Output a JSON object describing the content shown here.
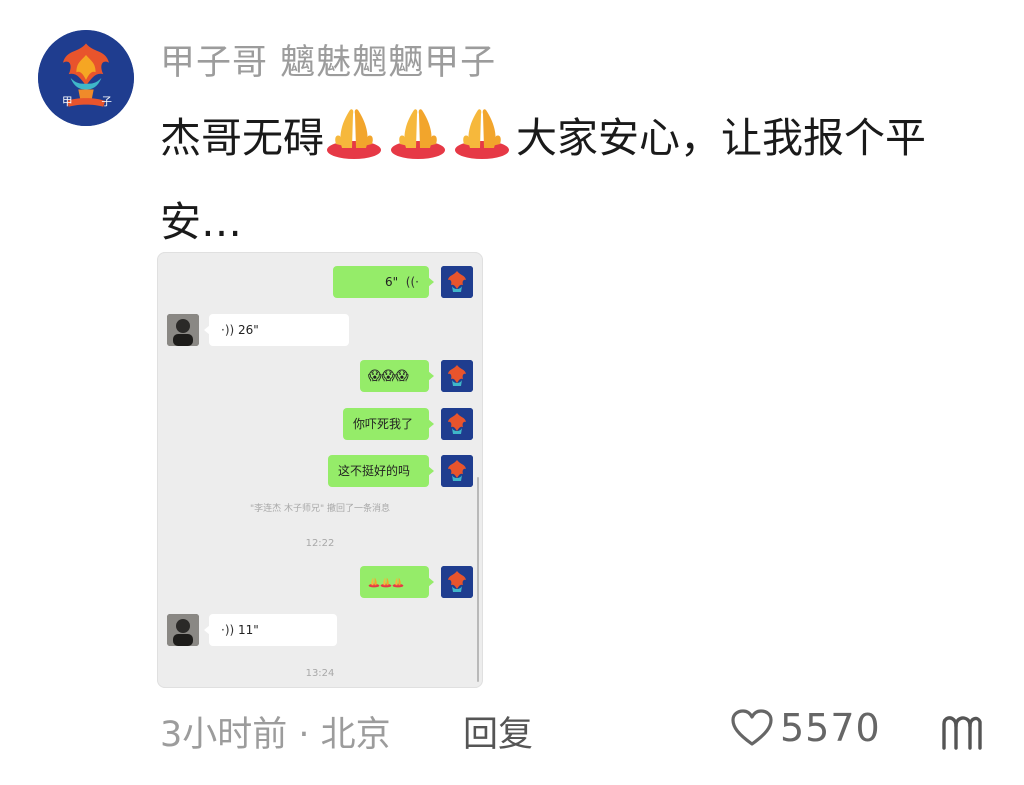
{
  "post": {
    "username": "甲子哥 魑魅魍魉甲子",
    "avatar_icon": "fire-lotus-avatar-icon",
    "avatar_text": [
      "甲",
      "子"
    ],
    "comment_before": "杰哥无碍",
    "comment_after": "大家安心，让我报个平安…",
    "emoji": "folded-hands-icon",
    "emoji_count": 3
  },
  "chat": {
    "messages": [
      {
        "side": "self",
        "type": "voice",
        "text": "6\""
      },
      {
        "side": "other",
        "type": "voice",
        "text": "26\""
      },
      {
        "side": "self",
        "type": "emoji",
        "text": "😱😱😱"
      },
      {
        "side": "self",
        "type": "text",
        "text": "你吓死我了"
      },
      {
        "side": "self",
        "type": "text",
        "text": "这不挺好的吗"
      },
      {
        "side": "self",
        "type": "emoji",
        "text": "🙏🙏🙏"
      },
      {
        "side": "other",
        "type": "voice",
        "text": "11\""
      }
    ],
    "system_recall": "\"李连杰 木子师兄\" 撤回了一条消息",
    "time_1": "12:22",
    "time_2": "13:24",
    "bubble_color": "#95ec69"
  },
  "footer": {
    "meta": "3小时前 · 北京",
    "reply_label": "回复",
    "like_count": "5570",
    "more_icon": "more-icon"
  }
}
